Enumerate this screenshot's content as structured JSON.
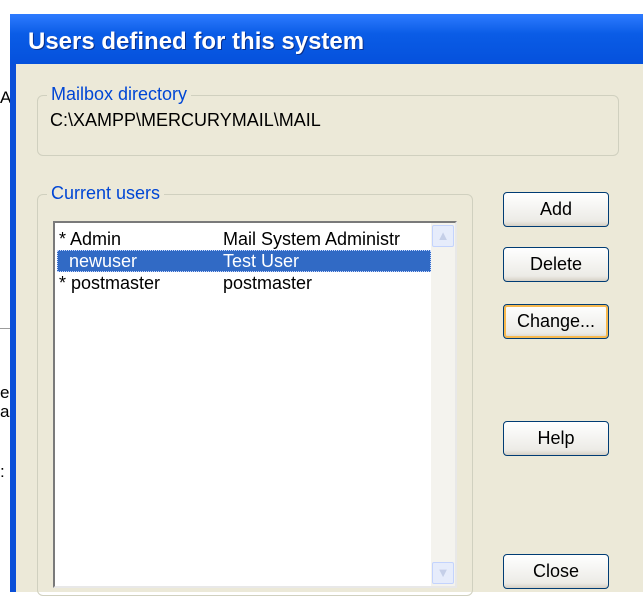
{
  "dialog": {
    "title": "Users defined for this system"
  },
  "mailbox": {
    "legend": "Mailbox directory",
    "path": "C:\\XAMPP\\MERCURYMAIL\\MAIL"
  },
  "users": {
    "legend": "Current users",
    "rows": [
      {
        "name": "* Admin",
        "full_name": "Mail System Administr",
        "selected": false
      },
      {
        "name": "  newuser",
        "full_name": "Test User",
        "selected": true
      },
      {
        "name": "* postmaster",
        "full_name": "postmaster",
        "selected": false
      }
    ]
  },
  "buttons": {
    "add": "Add",
    "delete": "Delete",
    "change": "Change...",
    "help": "Help",
    "close": "Close"
  },
  "colors": {
    "title_bar": "#0a5ce6",
    "selection": "#316ac5",
    "legend_text": "#0046d5",
    "dialog_face": "#ece9d8"
  }
}
